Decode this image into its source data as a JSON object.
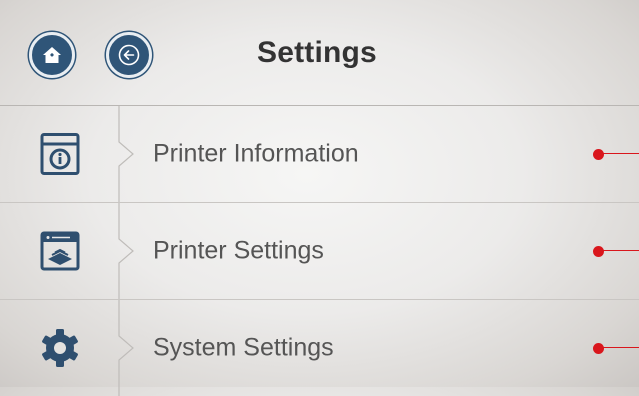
{
  "header": {
    "title": "Settings",
    "home_icon": "home-icon",
    "back_icon": "arrow-left-icon"
  },
  "menu": {
    "items": [
      {
        "label": "Printer Information",
        "icon": "info-panel-icon"
      },
      {
        "label": "Printer Settings",
        "icon": "print-bed-icon"
      },
      {
        "label": "System Settings",
        "icon": "gear-icon"
      }
    ]
  },
  "colors": {
    "accent": "#2f5578",
    "indicator": "#d9161c",
    "text": "#555555"
  }
}
